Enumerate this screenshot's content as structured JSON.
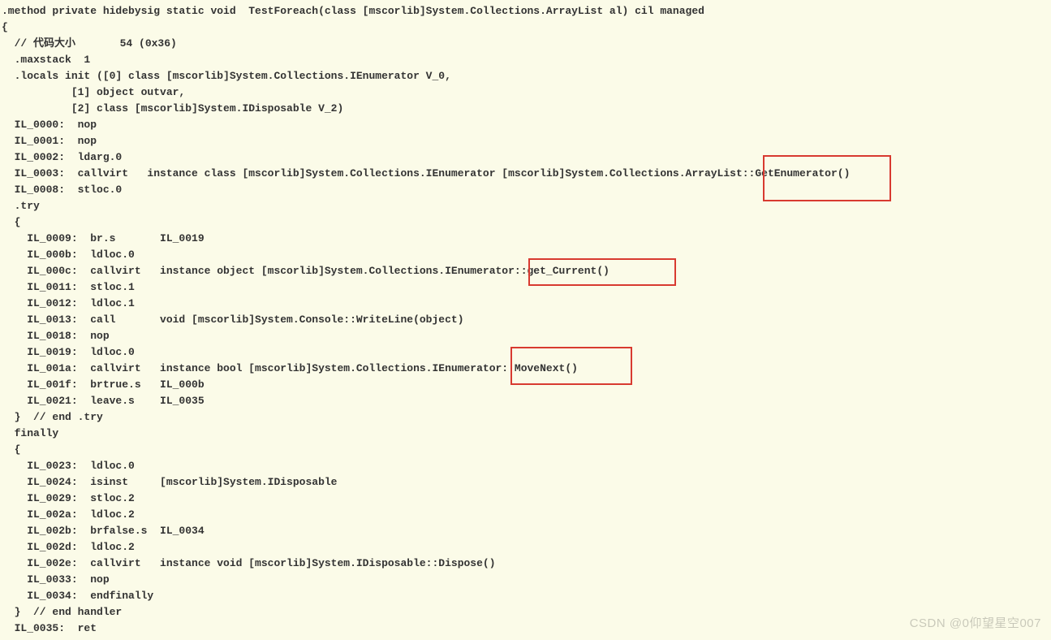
{
  "code": {
    "l01": ".method private hidebysig static void  TestForeach(class [mscorlib]System.Collections.ArrayList al) cil managed",
    "l02": "{",
    "l03": "  // 代码大小       54 (0x36)",
    "l04": "  .maxstack  1",
    "l05": "  .locals init ([0] class [mscorlib]System.Collections.IEnumerator V_0,",
    "l06": "           [1] object outvar,",
    "l07": "           [2] class [mscorlib]System.IDisposable V_2)",
    "l08": "  IL_0000:  nop",
    "l09": "  IL_0001:  nop",
    "l10": "  IL_0002:  ldarg.0",
    "l11": "  IL_0003:  callvirt   instance class [mscorlib]System.Collections.IEnumerator [mscorlib]System.Collections.ArrayList::GetEnumerator()",
    "l12": "  IL_0008:  stloc.0",
    "l13": "  .try",
    "l14": "  {",
    "l15": "    IL_0009:  br.s       IL_0019",
    "l16": "    IL_000b:  ldloc.0",
    "l17": "    IL_000c:  callvirt   instance object [mscorlib]System.Collections.IEnumerator::get_Current()",
    "l18": "    IL_0011:  stloc.1",
    "l19": "    IL_0012:  ldloc.1",
    "l20": "    IL_0013:  call       void [mscorlib]System.Console::WriteLine(object)",
    "l21": "    IL_0018:  nop",
    "l22": "    IL_0019:  ldloc.0",
    "l23": "    IL_001a:  callvirt   instance bool [mscorlib]System.Collections.IEnumerator::MoveNext()",
    "l24": "    IL_001f:  brtrue.s   IL_000b",
    "l25": "    IL_0021:  leave.s    IL_0035",
    "l26": "  }  // end .try",
    "l27": "  finally",
    "l28": "  {",
    "l29": "    IL_0023:  ldloc.0",
    "l30": "    IL_0024:  isinst     [mscorlib]System.IDisposable",
    "l31": "    IL_0029:  stloc.2",
    "l32": "    IL_002a:  ldloc.2",
    "l33": "    IL_002b:  brfalse.s  IL_0034",
    "l34": "    IL_002d:  ldloc.2",
    "l35": "    IL_002e:  callvirt   instance void [mscorlib]System.IDisposable::Dispose()",
    "l36": "    IL_0033:  nop",
    "l37": "    IL_0034:  endfinally",
    "l38": "  }  // end handler",
    "l39": "  IL_0035:  ret"
  },
  "highlights": {
    "box1_text": "::GetEnumerator()",
    "box2_text": "::get_Current()",
    "box3_text": "::MoveNext()"
  },
  "watermark": "CSDN @0仰望星空007"
}
